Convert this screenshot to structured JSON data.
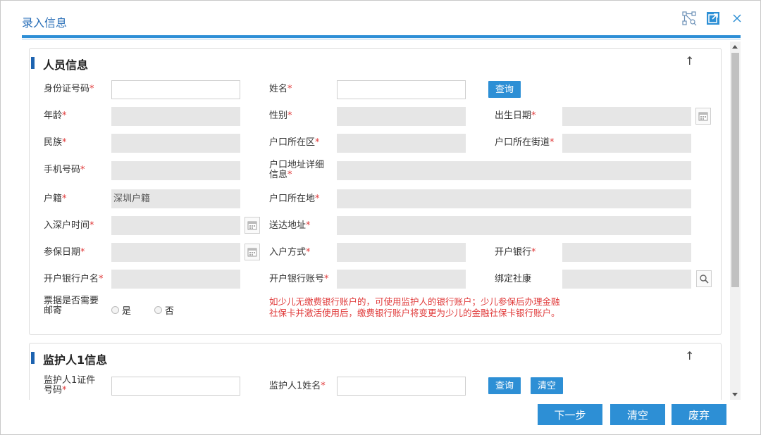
{
  "dialog": {
    "title": "录入信息"
  },
  "section1": {
    "title": "人员信息",
    "fields": {
      "id_no": {
        "label": "身份证号码",
        "value": ""
      },
      "name": {
        "label": "姓名",
        "value": ""
      },
      "query_btn": "查询",
      "age": {
        "label": "年龄",
        "value": ""
      },
      "gender": {
        "label": "性别",
        "value": ""
      },
      "birth": {
        "label": "出生日期",
        "value": ""
      },
      "ethnic": {
        "label": "民族",
        "value": ""
      },
      "hukou_district": {
        "label": "户口所在区",
        "value": ""
      },
      "hukou_street": {
        "label": "户口所在街道",
        "value": ""
      },
      "phone": {
        "label": "手机号码",
        "value": ""
      },
      "hukou_detail": {
        "label_line1": "户口地址详细",
        "label_line2": "信息",
        "value": ""
      },
      "huji": {
        "label": "户籍",
        "value": "深圳户籍"
      },
      "hukou_place": {
        "label": "户口所在地",
        "value": ""
      },
      "sz_time": {
        "label": "入深户时间",
        "value": ""
      },
      "delivery": {
        "label": "送达地址",
        "value": ""
      },
      "insure_date": {
        "label": "参保日期",
        "value": ""
      },
      "entry_way": {
        "label": "入户方式",
        "value": ""
      },
      "bank": {
        "label": "开户银行",
        "value": ""
      },
      "acct_name": {
        "label": "开户银行户名",
        "value": ""
      },
      "acct_no": {
        "label": "开户银行账号",
        "value": ""
      },
      "bind_sk": {
        "label": "绑定社康",
        "value": ""
      },
      "mail": {
        "label_line1": "票据是否需要",
        "label_line2": "邮寄",
        "opt_yes": "是",
        "opt_no": "否"
      }
    },
    "note_line1": "如少儿无缴费银行账户的，可使用监护人的银行账户；少儿参保后办理金融",
    "note_line2": "社保卡并激活使用后，缴费银行账户将变更为少儿的金融社保卡银行账户。"
  },
  "section2": {
    "title": "监护人1信息",
    "id_label_line1": "监护人1证件",
    "id_label_line2": "号码",
    "id_value": "",
    "name_label": "监护人1姓名",
    "name_value": "",
    "query_btn": "查询",
    "clear_btn": "清空"
  },
  "footer": {
    "next": "下一步",
    "clear": "清空",
    "discard": "废弃"
  },
  "required_mark": "*",
  "colors": {
    "accent": "#2d8fd5",
    "required": "#e03a3a",
    "disabled": "#e6e6e6"
  }
}
